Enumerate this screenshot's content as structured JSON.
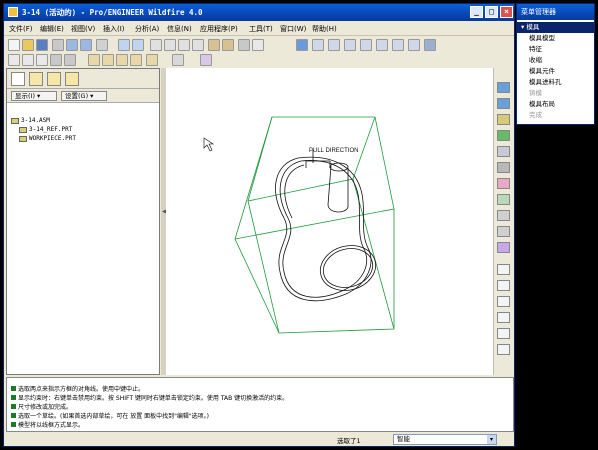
{
  "window": {
    "title": "3-14 (活动的) - Pro/ENGINEER Wildfire 4.0",
    "minimize": "_",
    "maximize": "□",
    "close": "×"
  },
  "menubar": [
    "文件(F)",
    "编辑(E)",
    "视图(V)",
    "插入(I)",
    "分析(A)",
    "信息(N)",
    "应用程序(P)",
    "工具(T)",
    "窗口(W)",
    "帮助(H)"
  ],
  "left_panel": {
    "dropdowns": [
      "显示(I) ▾",
      "设置(G) ▾"
    ],
    "tree": [
      "3-14.ASM",
      "3-14_REF.PRT",
      "WORKPIECE.PRT"
    ]
  },
  "splitter": {
    "arrow": "◀"
  },
  "viewport": {
    "label": "PULL DIRECTION",
    "colors": {
      "box": "#1e9a3c",
      "part": "#111111",
      "pull_arrow": "#111111"
    }
  },
  "messages": [
    "选取两点来指示方框的对角线。使用中键中止。",
    "显示约束时：右键单击禁用约束。按 SHIFT 键同时右键单击锁定约束。使用 TAB 键切换激活的约束。",
    "尺寸修改或加完成。",
    "选取一个草绘。(如果首选内部草绘，可在 放置 面板中找到\"编辑\"选项。)",
    "模型将以线框方式显示。"
  ],
  "status": {
    "selected": "选取了1",
    "filter": "智能",
    "filter_arrow": "▾"
  },
  "menu_manager": {
    "title": "菜单管理器",
    "header": "▾ 模具",
    "items": [
      {
        "label": "模具模型",
        "enabled": true
      },
      {
        "label": "特征",
        "enabled": true
      },
      {
        "label": "收缩",
        "enabled": true
      },
      {
        "label": "模具元件",
        "enabled": true
      },
      {
        "label": "模具进料孔",
        "enabled": true
      },
      {
        "label": "铸模",
        "enabled": false
      },
      {
        "label": "模具布局",
        "enabled": true
      },
      {
        "label": "完成",
        "enabled": false
      }
    ]
  }
}
